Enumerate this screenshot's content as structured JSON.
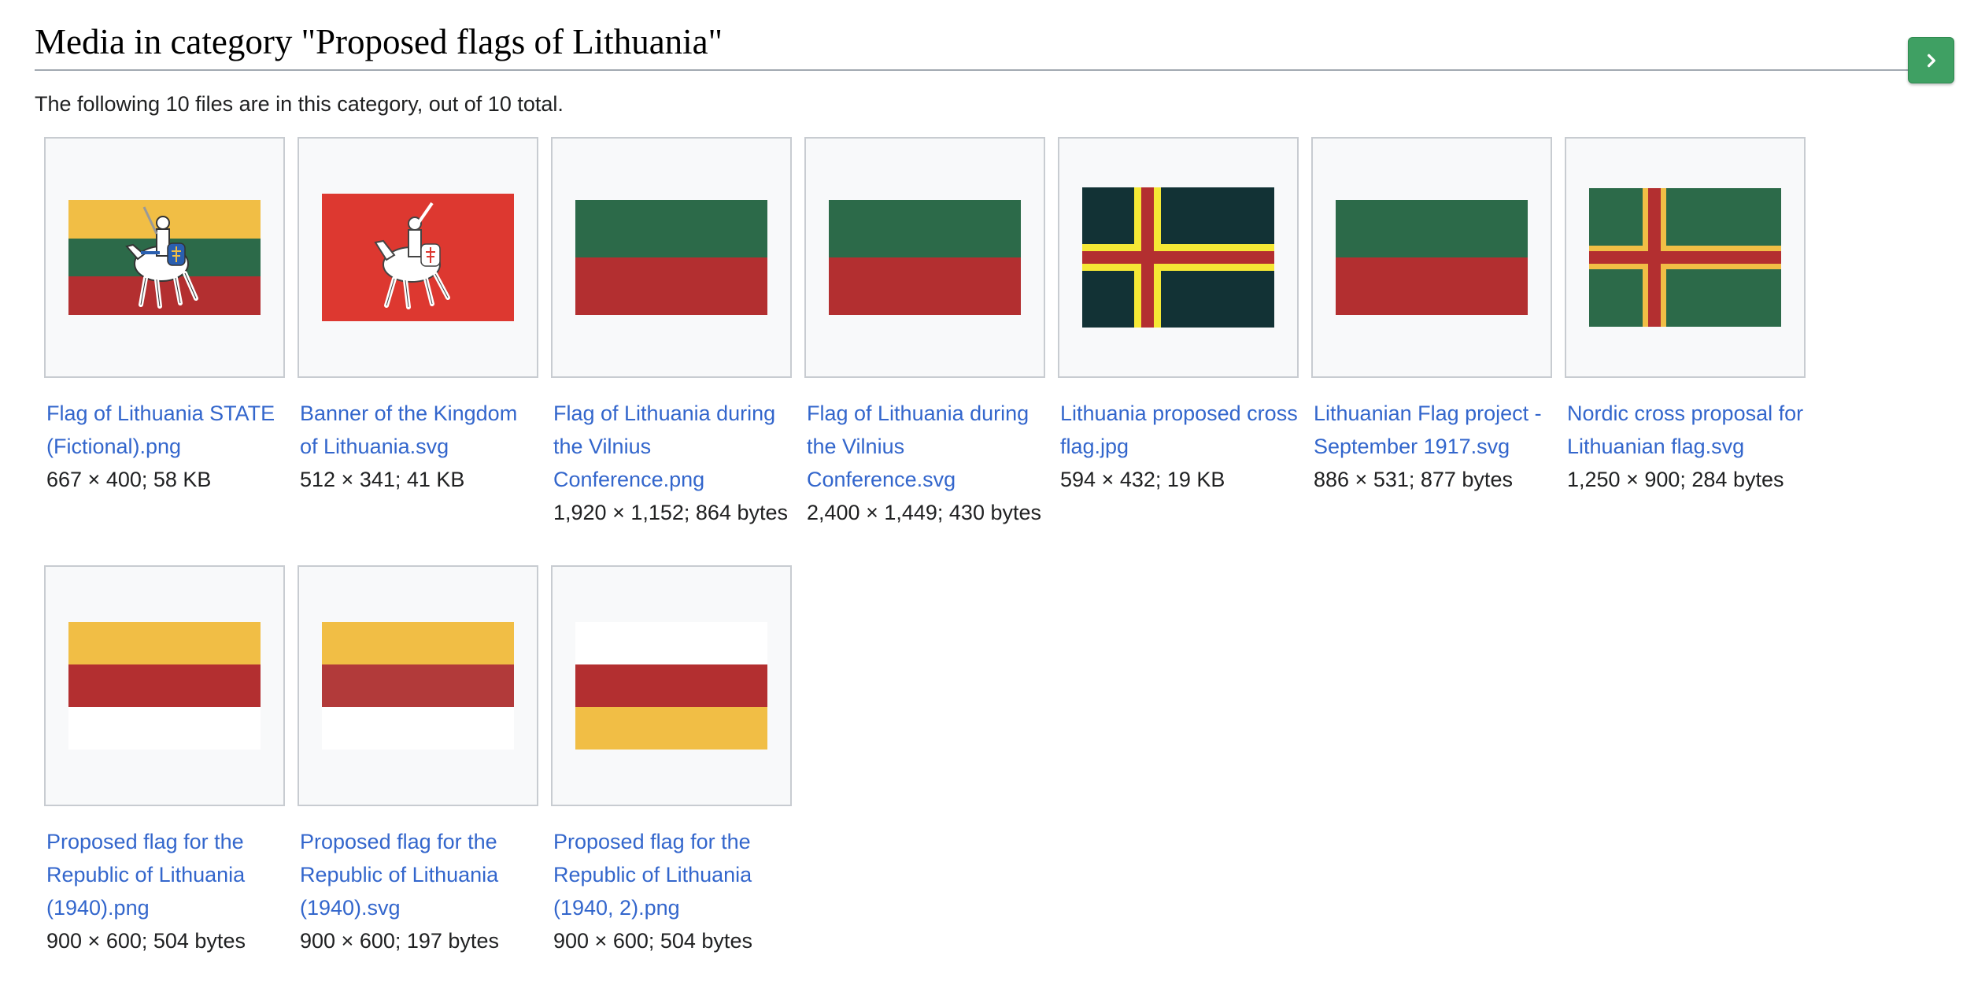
{
  "heading": "Media in category \"Proposed flags of Lithuania\"",
  "subtitle": "The following 10 files are in this category, out of 10 total.",
  "next_icon": "chevron-right-icon",
  "colors": {
    "link": "#3366cc",
    "button": "#3fa063",
    "lt_yellow": "#f1be45",
    "lt_green": "#2c6a49",
    "lt_red": "#b32f30",
    "banner_red": "#dd3830",
    "dark_teal": "#123235",
    "cross_yellow": "#f5e835"
  },
  "files": [
    {
      "name": "Flag of Lithuania STATE (Fictional).png",
      "meta": "667 × 400; 58 KB"
    },
    {
      "name": "Banner of the Kingdom of Lithuania.svg",
      "meta": "512 × 341; 41 KB"
    },
    {
      "name": "Flag of Lithuania during the Vilnius Conference.png",
      "meta": "1,920 × 1,152; 864 bytes"
    },
    {
      "name": "Flag of Lithuania during the Vilnius Conference.svg",
      "meta": "2,400 × 1,449; 430 bytes"
    },
    {
      "name": "Lithuania proposed cross flag.jpg",
      "meta": "594 × 432; 19 KB"
    },
    {
      "name": "Lithuanian Flag project - September 1917.svg",
      "meta": "886 × 531; 877 bytes"
    },
    {
      "name": "Nordic cross proposal for Lithuanian flag.svg",
      "meta": "1,250 × 900; 284 bytes"
    },
    {
      "name": "Proposed flag for the Republic of Lithuania (1940).png",
      "meta": "900 × 600; 504 bytes"
    },
    {
      "name": "Proposed flag for the Republic of Lithuania (1940).svg",
      "meta": "900 × 600; 197 bytes"
    },
    {
      "name": "Proposed flag for the Republic of Lithuania (1940, 2).png",
      "meta": "900 × 600; 504 bytes"
    }
  ]
}
